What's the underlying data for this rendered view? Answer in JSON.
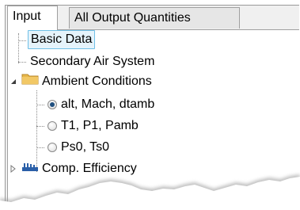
{
  "tabs": [
    {
      "label": "Input",
      "active": true
    },
    {
      "label": "All Output Quantities",
      "active": false
    }
  ],
  "tree": {
    "items": [
      {
        "label": "Basic Data",
        "selected": true
      },
      {
        "label": "Secondary Air System"
      },
      {
        "label": "Ambient Conditions",
        "icon": "folder-icon",
        "expanded": true,
        "children": [
          {
            "label": "alt, Mach, dtamb",
            "checked": true
          },
          {
            "label": "T1, P1, Pamb",
            "checked": false
          },
          {
            "label": "Ps0, Ts0",
            "checked": false
          }
        ]
      },
      {
        "label": "Comp. Efficiency",
        "icon": "compressor-icon",
        "expanded": false
      }
    ]
  },
  "colors": {
    "selection_bg": "#e5f3fb",
    "selection_border": "#70c0e7",
    "folder": "#e8b84a",
    "compressor_icon": "#2a5fa8"
  }
}
